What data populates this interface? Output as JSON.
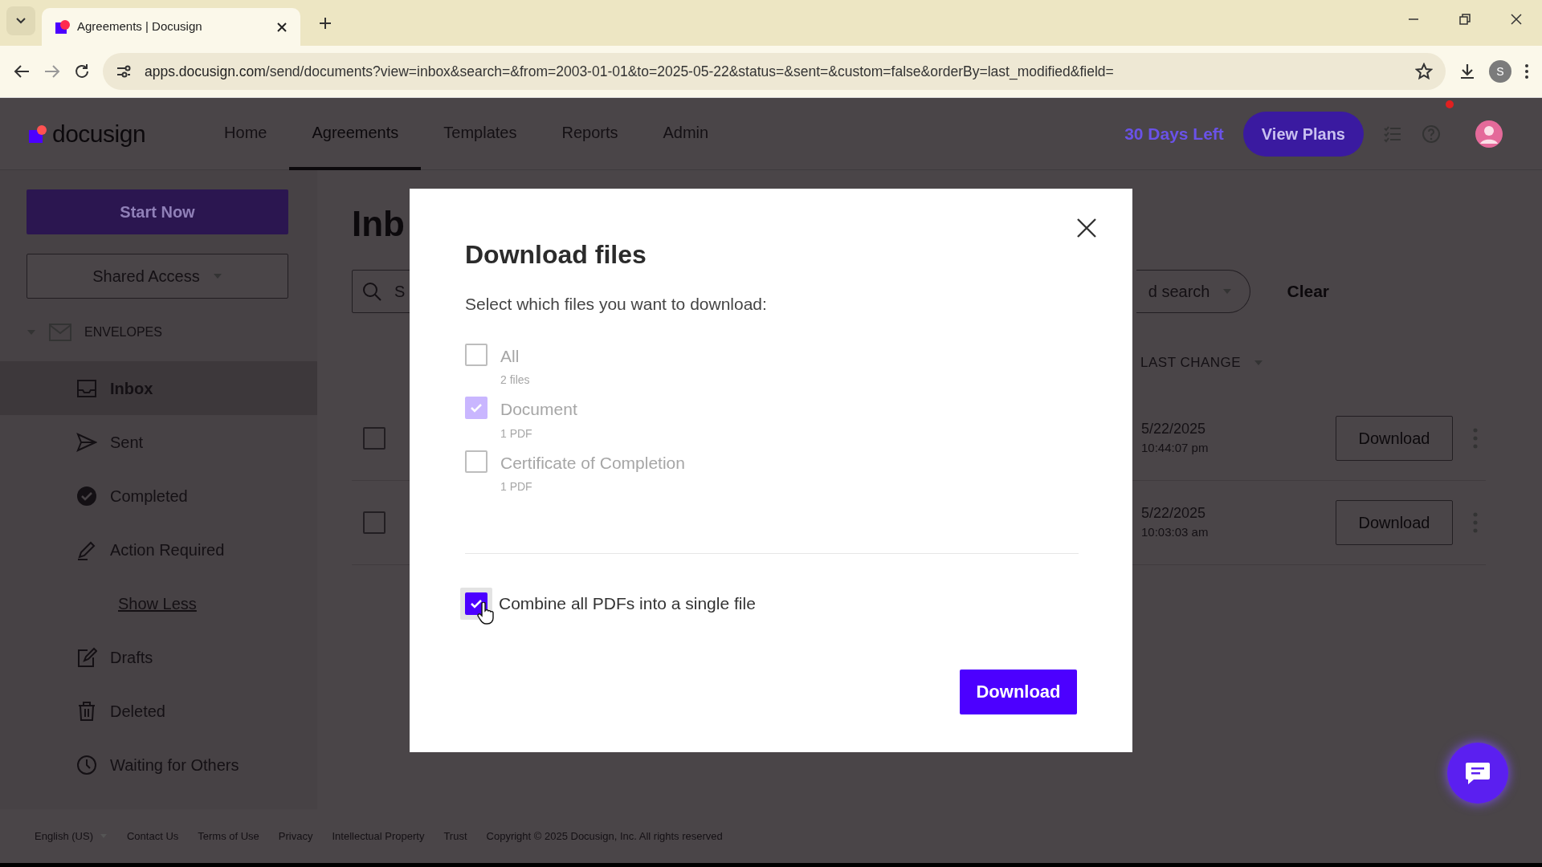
{
  "browser": {
    "tab_title": "Agreements | Docusign",
    "url_host": "apps.docusign.com",
    "url_path": "/send/documents?view=inbox&search=&from=2003-01-01&to=2025-05-22&status=&sent=&custom=false&orderBy=last_modified&field=",
    "profile_initial": "S"
  },
  "header": {
    "logo": "docusign",
    "nav": [
      {
        "label": "Home",
        "selected": false
      },
      {
        "label": "Agreements",
        "selected": true
      },
      {
        "label": "Templates",
        "selected": false
      },
      {
        "label": "Reports",
        "selected": false
      },
      {
        "label": "Admin",
        "selected": false
      }
    ],
    "trial": "30 Days Left",
    "plans_button": "View Plans"
  },
  "sidebar": {
    "start_button": "Start Now",
    "shared_access": "Shared Access",
    "section": "ENVELOPES",
    "items": [
      {
        "kind": "inbox",
        "label": "Inbox",
        "selected": true
      },
      {
        "kind": "sent",
        "label": "Sent",
        "selected": false
      },
      {
        "kind": "completed",
        "label": "Completed",
        "selected": false
      },
      {
        "kind": "action",
        "label": "Action Required",
        "selected": false
      },
      {
        "kind": "toggle",
        "label": "Show Less",
        "selected": false
      },
      {
        "kind": "drafts",
        "label": "Drafts",
        "selected": false
      },
      {
        "kind": "deleted",
        "label": "Deleted",
        "selected": false
      },
      {
        "kind": "waiting",
        "label": "Waiting for Others",
        "selected": false
      }
    ]
  },
  "main": {
    "title": "Inb",
    "search": {
      "placeholder": "S"
    },
    "filter": "d search",
    "clear": "Clear",
    "column": "LAST CHANGE",
    "rows": [
      {
        "checked": false,
        "date": "5/22/2025",
        "time": "10:44:07 pm",
        "action": "Download"
      },
      {
        "checked": false,
        "date": "5/22/2025",
        "time": "10:03:03 am",
        "action": "Download"
      }
    ]
  },
  "modal": {
    "title": "Download files",
    "subtitle": "Select which files you want to download:",
    "options": [
      {
        "label": "All",
        "detail": "2 files",
        "checked": false,
        "disabled": true
      },
      {
        "label": "Document",
        "detail": "1 PDF",
        "checked": true,
        "disabled": true
      },
      {
        "label": "Certificate of Completion",
        "detail": "1 PDF",
        "checked": false,
        "disabled": true
      }
    ],
    "combine": {
      "label": "Combine all PDFs into a single file",
      "checked": true
    },
    "button": "Download"
  },
  "footer": {
    "language": "English (US)",
    "links": [
      "Contact Us",
      "Terms of Use",
      "Privacy",
      "Intellectual Property",
      "Trust"
    ],
    "copyright": "Copyright © 2025 Docusign, Inc. All rights reserved"
  }
}
